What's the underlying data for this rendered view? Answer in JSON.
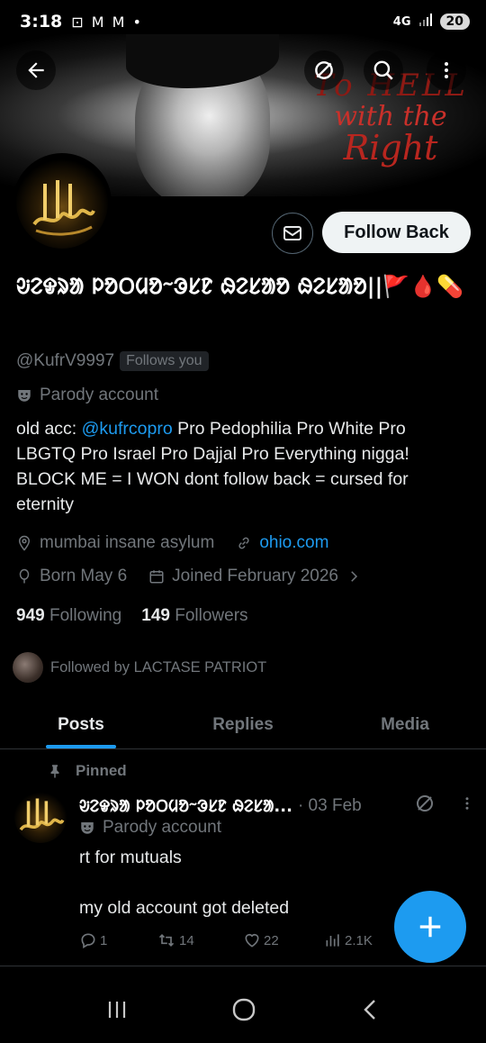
{
  "status_bar": {
    "time": "3:18",
    "network": "4G",
    "battery": "20"
  },
  "banner": {
    "line1": "To HELL",
    "line2": "with the",
    "line3": "Right"
  },
  "actions": {
    "follow_label": "Follow Back"
  },
  "profile": {
    "display_name": "ᱶᱮᱫᱨᱟ ᱞᱚᱛᱢᱚᱻᱳᱥᱱ ᱷᱮᱥᱟᱚ ᱷᱮᱥᱟᱚ||🚩🩸💊",
    "handle": "@KufrV9997",
    "follows_you": "Follows you",
    "parody": "Parody account",
    "bio_prefix": "old acc: ",
    "bio_link": "@kufrcopro",
    "bio_text": "  Pro Pedophilia Pro White Pro LBGTQ Pro Israel Pro Dajjal Pro Everything nigga! BLOCK ME = I WON  dont follow back = cursed for eternity",
    "location": "mumbai insane asylum",
    "website": "ohio.com",
    "born": "Born May 6",
    "joined": "Joined February 2026",
    "following_count": "949",
    "following_label": "Following",
    "followers_count": "149",
    "followers_label": "Followers",
    "followed_by": "Followed by LACTASE PATRIOT"
  },
  "tabs": [
    {
      "label": "Posts",
      "active": true
    },
    {
      "label": "Replies",
      "active": false
    },
    {
      "label": "Media",
      "active": false
    }
  ],
  "post": {
    "pinned_label": "Pinned",
    "name": "ᱶᱮᱫᱨᱟ ᱞᱚᱛᱢᱚᱻᱳᱥᱱ ᱷᱮᱥᱟ...",
    "date": "· 03 Feb",
    "parody": "Parody account",
    "text_line1": "rt for mutuals",
    "text_line2": "my old account got deleted",
    "replies": "1",
    "reposts": "14",
    "likes": "22",
    "views": "2.1K"
  },
  "colors": {
    "accent": "#1d9bf0",
    "background": "#000000",
    "muted": "#71767b",
    "text": "#e7e9ea"
  }
}
